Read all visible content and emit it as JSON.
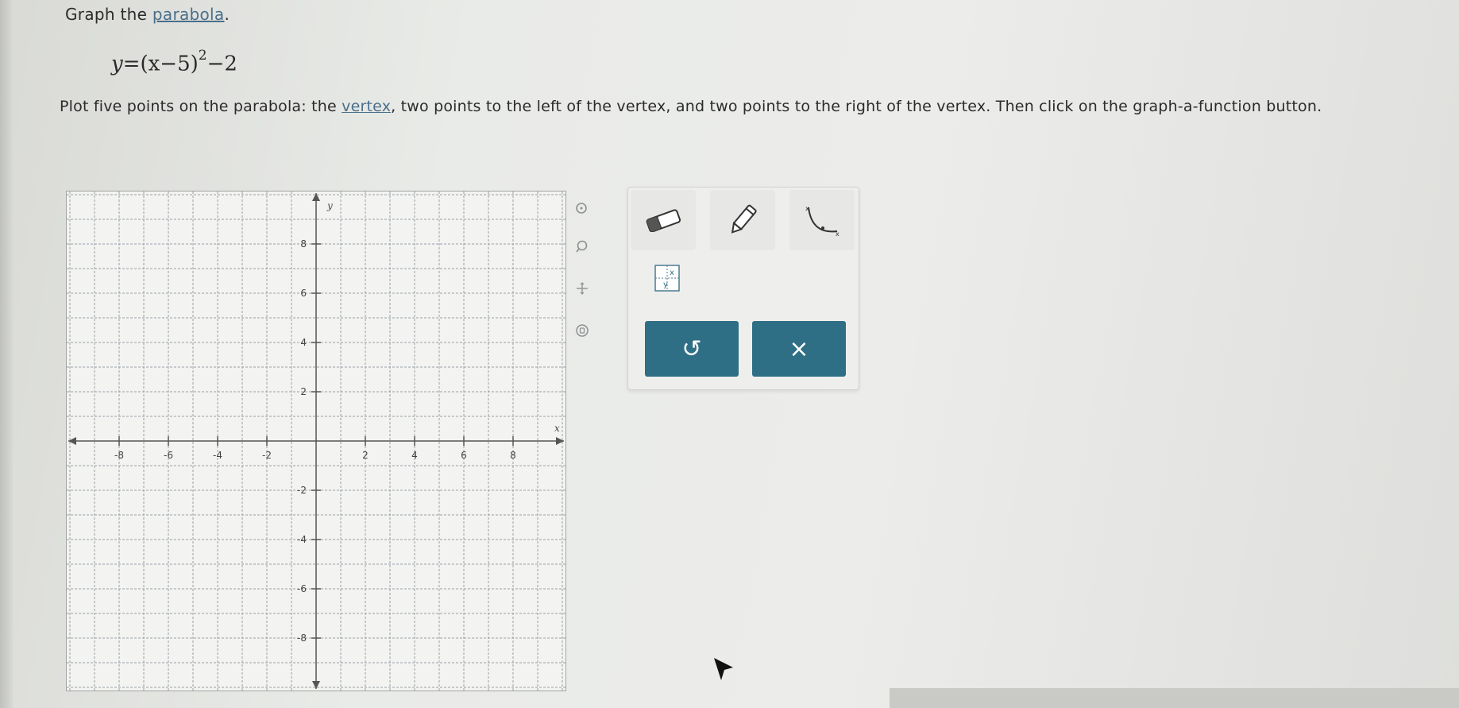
{
  "prompt": {
    "title_prefix": "Graph the ",
    "title_link": "parabola",
    "title_suffix": ".",
    "equation": {
      "lhs": "y",
      "base": "(x−5)",
      "exponent": "2",
      "tail": "−2"
    },
    "instructions_prefix": "Plot five points on the parabola: the ",
    "instructions_link": "vertex",
    "instructions_suffix": ", two points to the left of the vertex, and two points to the right of the vertex. Then click on the graph-a-function button."
  },
  "graph": {
    "x_label": "x",
    "y_label": "y",
    "x_ticks": [
      -8,
      -6,
      -4,
      -2,
      2,
      4,
      6,
      8
    ],
    "y_ticks": [
      8,
      6,
      4,
      2,
      -2,
      -4,
      -6,
      -8
    ],
    "range": [
      -10,
      10
    ],
    "grid": true
  },
  "side_icons": [
    "zoom-in-icon",
    "zoom-out-icon",
    "pan-icon",
    "settings-icon"
  ],
  "tools": {
    "eraser": "eraser-icon",
    "pencil": "pencil-icon",
    "parabola": "parabola-icon",
    "function_button": "graph-a-function-icon",
    "undo_symbol": "↺",
    "clear_symbol": "×"
  },
  "colors": {
    "action_button": "#2f6f86",
    "link": "#4a6f8a",
    "grid_line": "#9aa0a6"
  }
}
